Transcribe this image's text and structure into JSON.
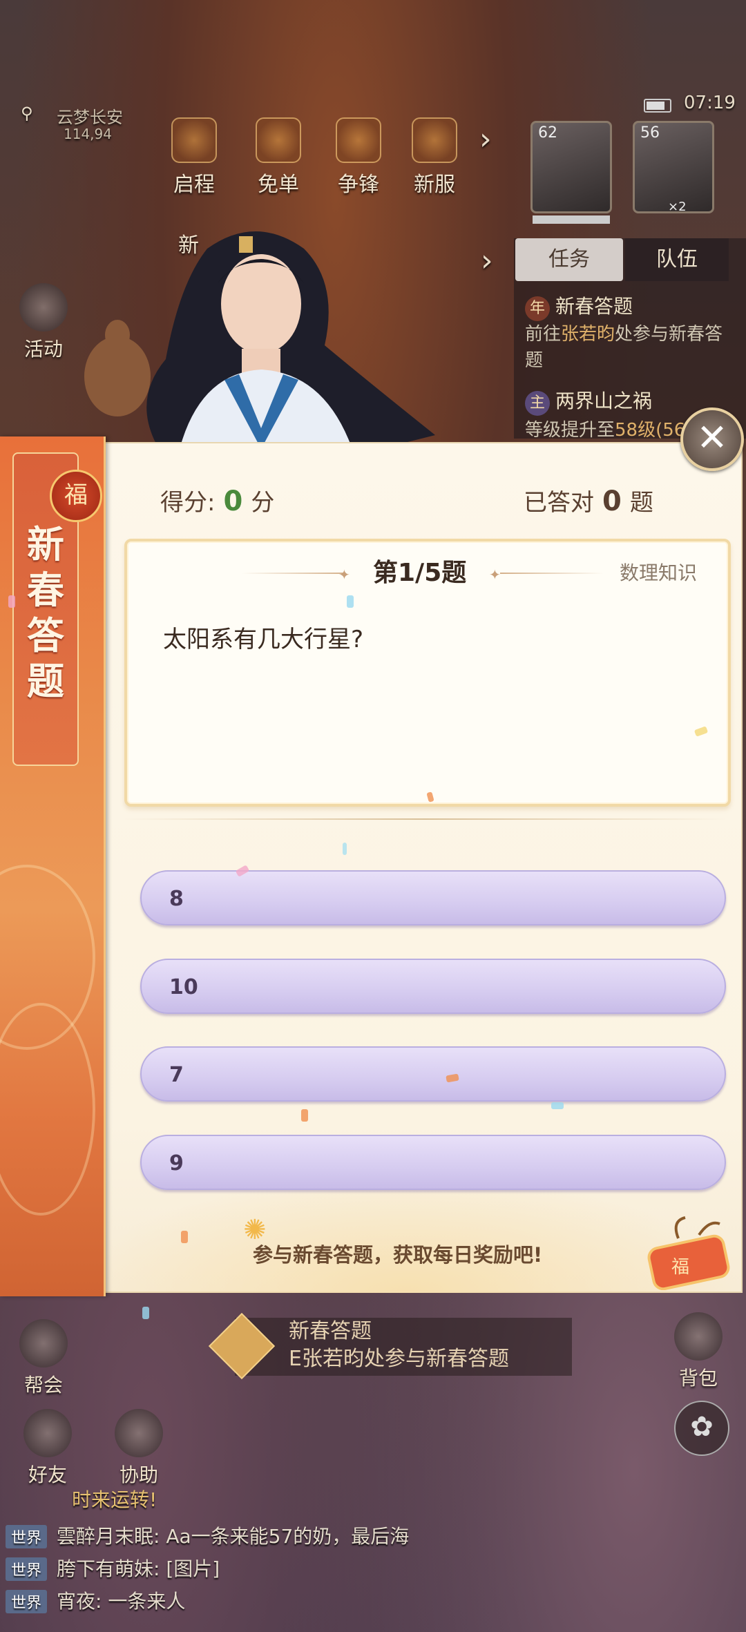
{
  "hud": {
    "server_name": "云梦长安",
    "server_coords": "114,94",
    "time": "07:19",
    "top_buttons": [
      "启程",
      "免单",
      "争锋",
      "新服"
    ],
    "partial_button": "新",
    "portraits": [
      {
        "level": "62"
      },
      {
        "level": "56",
        "badge": "×2"
      }
    ],
    "tabs": {
      "active": "任务",
      "idle": "队伍"
    },
    "tasks": [
      {
        "badge": "年",
        "title": "新春答题",
        "desc_pre": "前往",
        "desc_hl": "张若昀",
        "desc_post": "处参与新春答题"
      },
      {
        "badge": "主",
        "title": "两界山之祸",
        "desc_pre": "等级提升至",
        "desc_hl": "58级(56",
        "desc_post": ""
      }
    ],
    "side_buttons": [
      "活动",
      "帮会",
      "好友",
      "协助",
      "背包"
    ],
    "bottom_quest": {
      "title": "新春答题",
      "desc": "E张若昀处参与新春答题"
    },
    "chat_header": "时来运转!",
    "chat": [
      {
        "channel": "世界",
        "text": "雲醉月末眠: Aa一条来能57的奶，最后海"
      },
      {
        "channel": "世界",
        "text": "胯下有萌妹: [图片]"
      },
      {
        "channel": "世界",
        "text": "宵夜: 一条来人"
      }
    ]
  },
  "quiz": {
    "banner_title": "新春答题",
    "fu": "福",
    "close": "✕",
    "score_label": "得分:",
    "score_value": "0",
    "score_unit": "分",
    "correct_label": "已答对",
    "correct_value": "0",
    "correct_unit": "题",
    "question_number": "第1/5题",
    "category": "数理知识",
    "question": "太阳系有几大行星?",
    "options": [
      "8",
      "10",
      "7",
      "9"
    ],
    "footer_tip": "参与新春答题，获取每日奖励吧!"
  }
}
